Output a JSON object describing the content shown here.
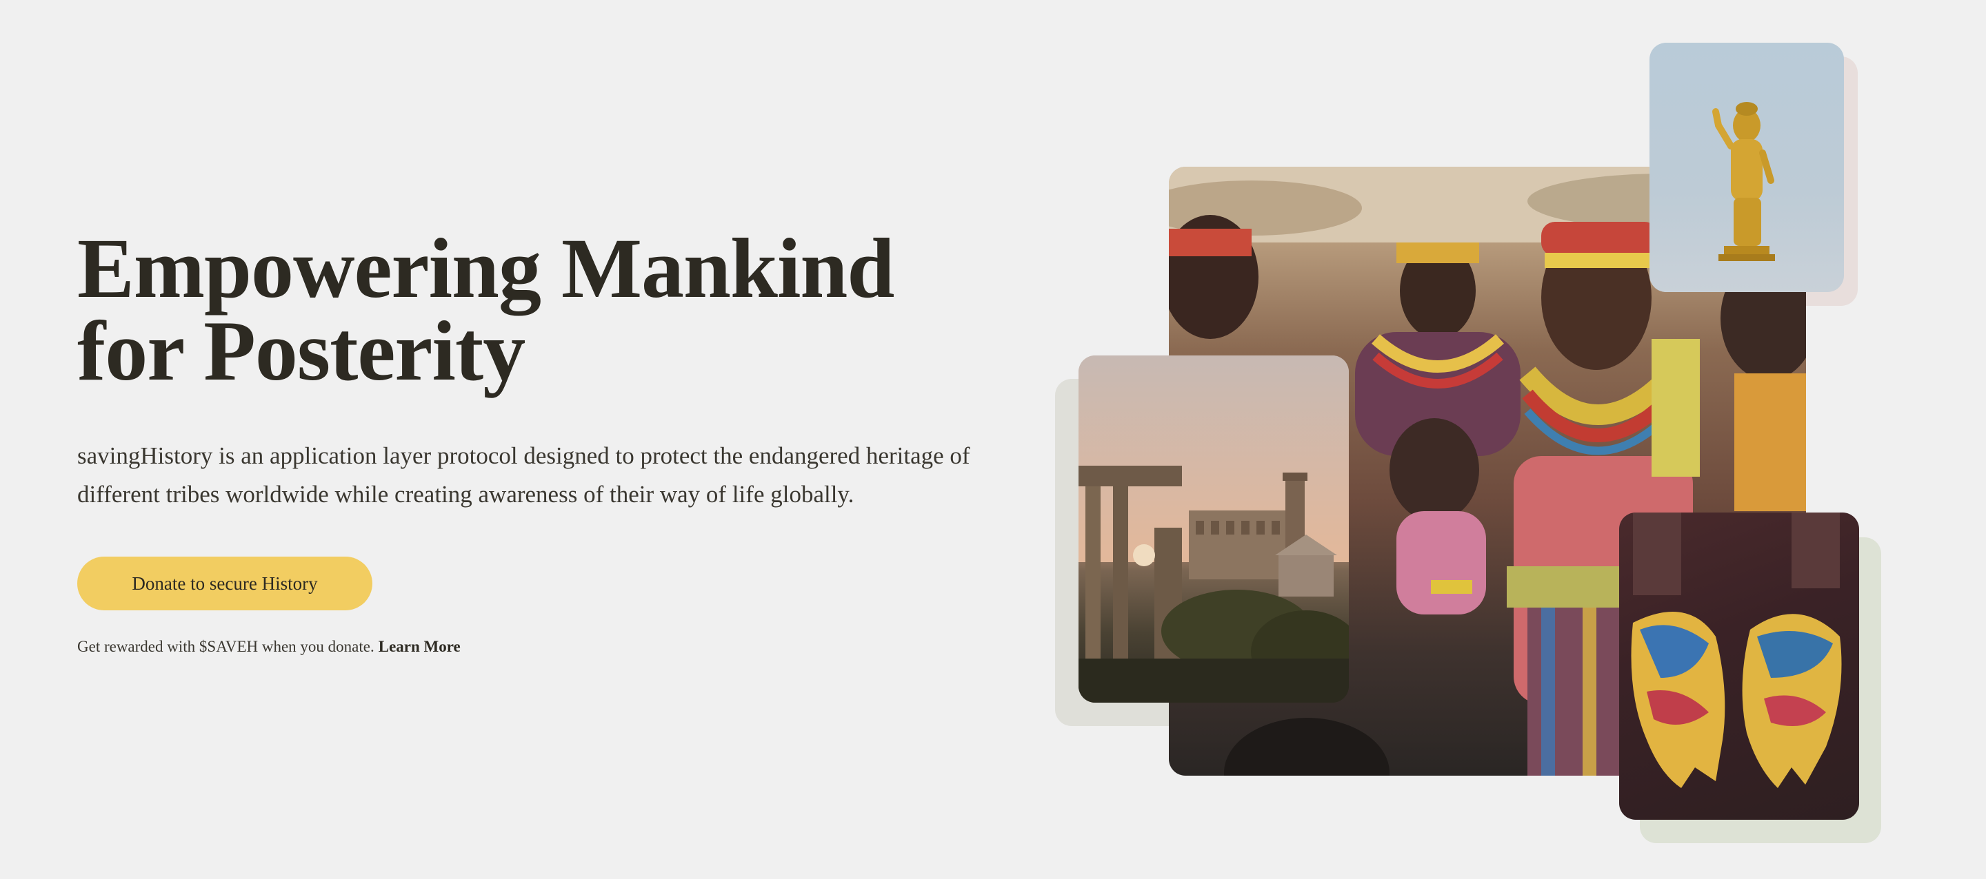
{
  "hero": {
    "title_line1": "Empowering Mankind",
    "title_line2": "for Posterity",
    "description": "savingHistory is an application layer protocol designed to protect the endangered heritage of different tribes worldwide while creating awareness of their way of life globally.",
    "donate_label": "Donate to secure History",
    "reward_text": "Get rewarded with $SAVEH when you donate.",
    "learn_more_label": "Learn More"
  },
  "colors": {
    "background": "#f0f0f0",
    "accent": "#f2cd61",
    "text": "#2d2a22"
  },
  "collage": [
    {
      "name": "tribe-women-photo",
      "description": "tribal women with colorful beaded necklaces"
    },
    {
      "name": "rome-ruins-photo",
      "description": "ancient ruins at sunset"
    },
    {
      "name": "buddha-statue-photo",
      "description": "golden statue on blue sky"
    },
    {
      "name": "painted-hands-photo",
      "description": "hands covered in colorful powder"
    }
  ]
}
